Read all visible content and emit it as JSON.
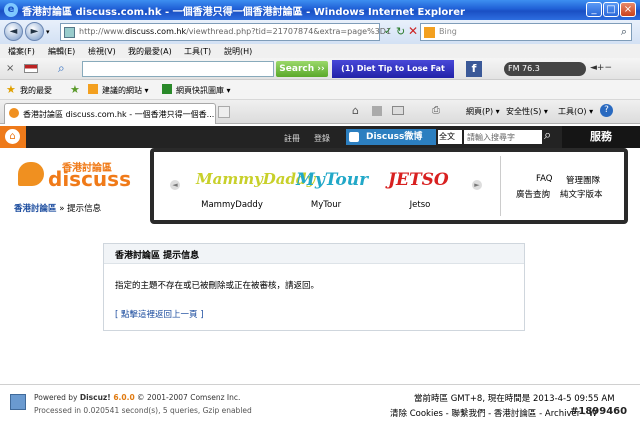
{
  "window": {
    "title": "香港討論區 discuss.com.hk - 一個香港只得一個香港討論區 - Windows Internet Explorer"
  },
  "address": {
    "url_prefix": "http://www.",
    "url_domain": "discuss.com.hk",
    "url_rest": "/viewthread.php?tid=21707874&extra=page%3D1"
  },
  "search": {
    "placeholder": "Bing"
  },
  "menu": {
    "items": [
      "檔案(F)",
      "編輯(E)",
      "檢視(V)",
      "我的最愛(A)",
      "工具(T)",
      "說明(H)"
    ]
  },
  "toolbar": {
    "search_label": "Search ››",
    "tip": "(1) Diet Tip to Lose Fat",
    "radio": "FM 76.3"
  },
  "favorites": {
    "label": "我的最愛",
    "items": [
      "建議的網站 ▾",
      "網頁快訊圖庫 ▾"
    ]
  },
  "tab": {
    "label": "香港討論區 discuss.com.hk - 一個香港只得一個香..."
  },
  "commands": {
    "items": [
      "網頁(P) ▾",
      "安全性(S) ▾",
      "工具(O) ▾"
    ]
  },
  "site": {
    "nav": {
      "register": "註冊",
      "login": "登錄",
      "weibo": "Discuss微博",
      "select": "全文",
      "search_placeholder": "請輸入搜尋字",
      "services": "服務"
    },
    "logo": {
      "cn": "香港討論區",
      "en": "discuss"
    },
    "breadcrumb": {
      "home": "香港討論區",
      "sep": " » ",
      "current": "提示信息"
    },
    "carousel": {
      "brands": [
        {
          "logo": "MammyDaddy",
          "label": "MammyDaddy"
        },
        {
          "logo": "MyTour",
          "label": "MyTour"
        },
        {
          "logo": "JETSO",
          "label": "Jetso"
        }
      ],
      "links": {
        "faq": "FAQ",
        "admin": "管理團隊",
        "ads": "廣告查詢",
        "text": "純文字版本"
      }
    },
    "notice": {
      "title": "香港討論區 提示信息",
      "message": "指定的主題不存在或已被刪除或正在被審核，請返回。",
      "back": "[ 點擊這裡返回上一頁 ]"
    },
    "footer": {
      "powered_prefix": "Powered by ",
      "powered_name": "Discuz! ",
      "powered_version": "6.0.0",
      "powered_suffix": " © 2001-2007 Comsenz Inc.",
      "processed": "Processed in 0.020541 second(s), 5 queries, Gzip enabled",
      "time": "當前時區 GMT+8, 現在時間是 2013-4-5 09:55 AM",
      "links": "清除 Cookies - 聯繫我們 - 香港討論區 - Archiver - W"
    },
    "watermark": "#1899460"
  },
  "colors": {
    "title_bar": "#1f5fd6",
    "site_header": "#232323",
    "accent": "#ee7a1a",
    "link": "#1a4b9e"
  }
}
